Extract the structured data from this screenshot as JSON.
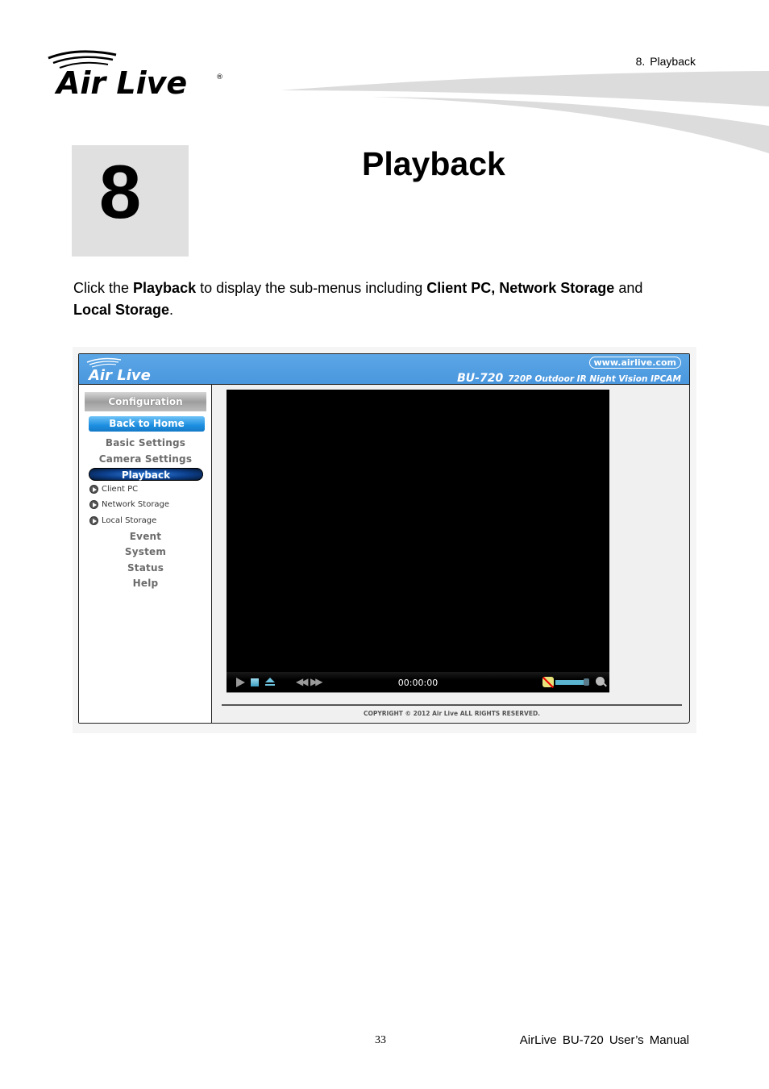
{
  "header": {
    "brand": "Air Live",
    "section_label": "8.  Playback"
  },
  "chapter": {
    "number": "8",
    "title": "Playback"
  },
  "intro": {
    "p1": "Click the ",
    "b1": "Playback",
    "p2": " to display the sub-menus including ",
    "b2": "Client PC, Network Storage",
    "p3": " and ",
    "b3": "Local Storage",
    "p4": "."
  },
  "screenshot": {
    "banner": {
      "brand": "Air Live",
      "url": "www.airlive.com",
      "model": "BU-720",
      "description": "720P Outdoor IR Night Vision IPCAM"
    },
    "sidebar": {
      "configuration": "Configuration",
      "back_to_home": "Back to Home",
      "items": [
        {
          "label": "Basic Settings"
        },
        {
          "label": "Camera Settings"
        },
        {
          "label": "Playback",
          "active": true
        }
      ],
      "sub_items": [
        {
          "label": "Client PC"
        },
        {
          "label": "Network Storage"
        },
        {
          "label": "Local Storage"
        }
      ],
      "items_after": [
        {
          "label": "Event"
        },
        {
          "label": "System"
        },
        {
          "label": "Status"
        },
        {
          "label": "Help"
        }
      ]
    },
    "player": {
      "time": "00:00:00",
      "volume_fraction": 0.9,
      "icons": [
        "play-icon",
        "stop-icon",
        "eject-icon",
        "rewind-icon",
        "fast-forward-icon",
        "mute-icon",
        "volume-slider",
        "zoom-icon"
      ]
    },
    "copyright": "COPYRIGHT © 2012 Air Live ALL RIGHTS RESERVED.",
    "colors": {
      "banner_blue": "#4b97de",
      "active_menu": "#0c3e8a",
      "home_button": "#1d8fe0"
    }
  },
  "footer": {
    "page_number": "33",
    "manual_title": "AirLive  BU-720  User’s  Manual"
  }
}
